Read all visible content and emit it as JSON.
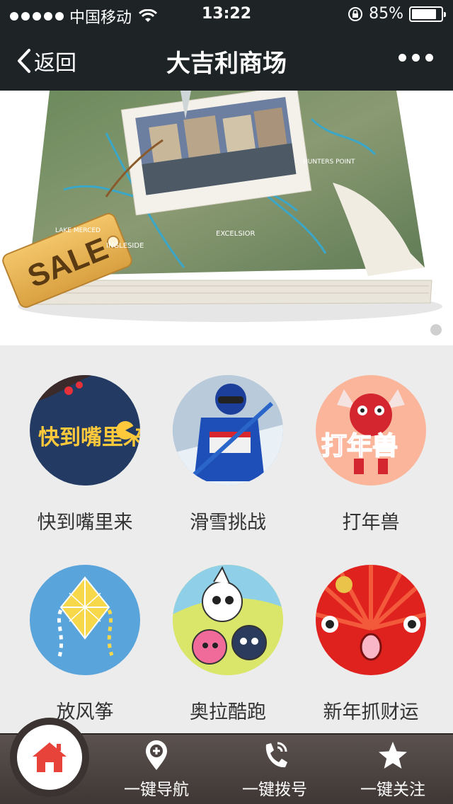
{
  "status": {
    "carrier": "中国移动",
    "time": "13:22",
    "battery_text": "85%",
    "battery_level": 0.85
  },
  "nav": {
    "back_label": "返回",
    "title": "大吉利商场"
  },
  "banner": {
    "sale_tag": "SALE",
    "map_labels": [
      "INGLESIDE",
      "EXCELSIOR",
      "LAKE MERCED",
      "HUNTERS POINT"
    ]
  },
  "games": [
    {
      "label": "快到嘴里来",
      "icon_text": "快到嘴里来"
    },
    {
      "label": "滑雪挑战"
    },
    {
      "label": "打年兽",
      "icon_text": "打年兽"
    },
    {
      "label": "放风筝"
    },
    {
      "label": "奥拉酷跑"
    },
    {
      "label": "新年抓财运"
    }
  ],
  "tabbar": {
    "nav_label": "一键导航",
    "call_label": "一键拨号",
    "follow_label": "一键关注"
  },
  "colors": {
    "bar_bg": "#1e2326",
    "page_bg": "#ececec",
    "tab_bg": "#4a4240",
    "home_red": "#e8433a"
  }
}
